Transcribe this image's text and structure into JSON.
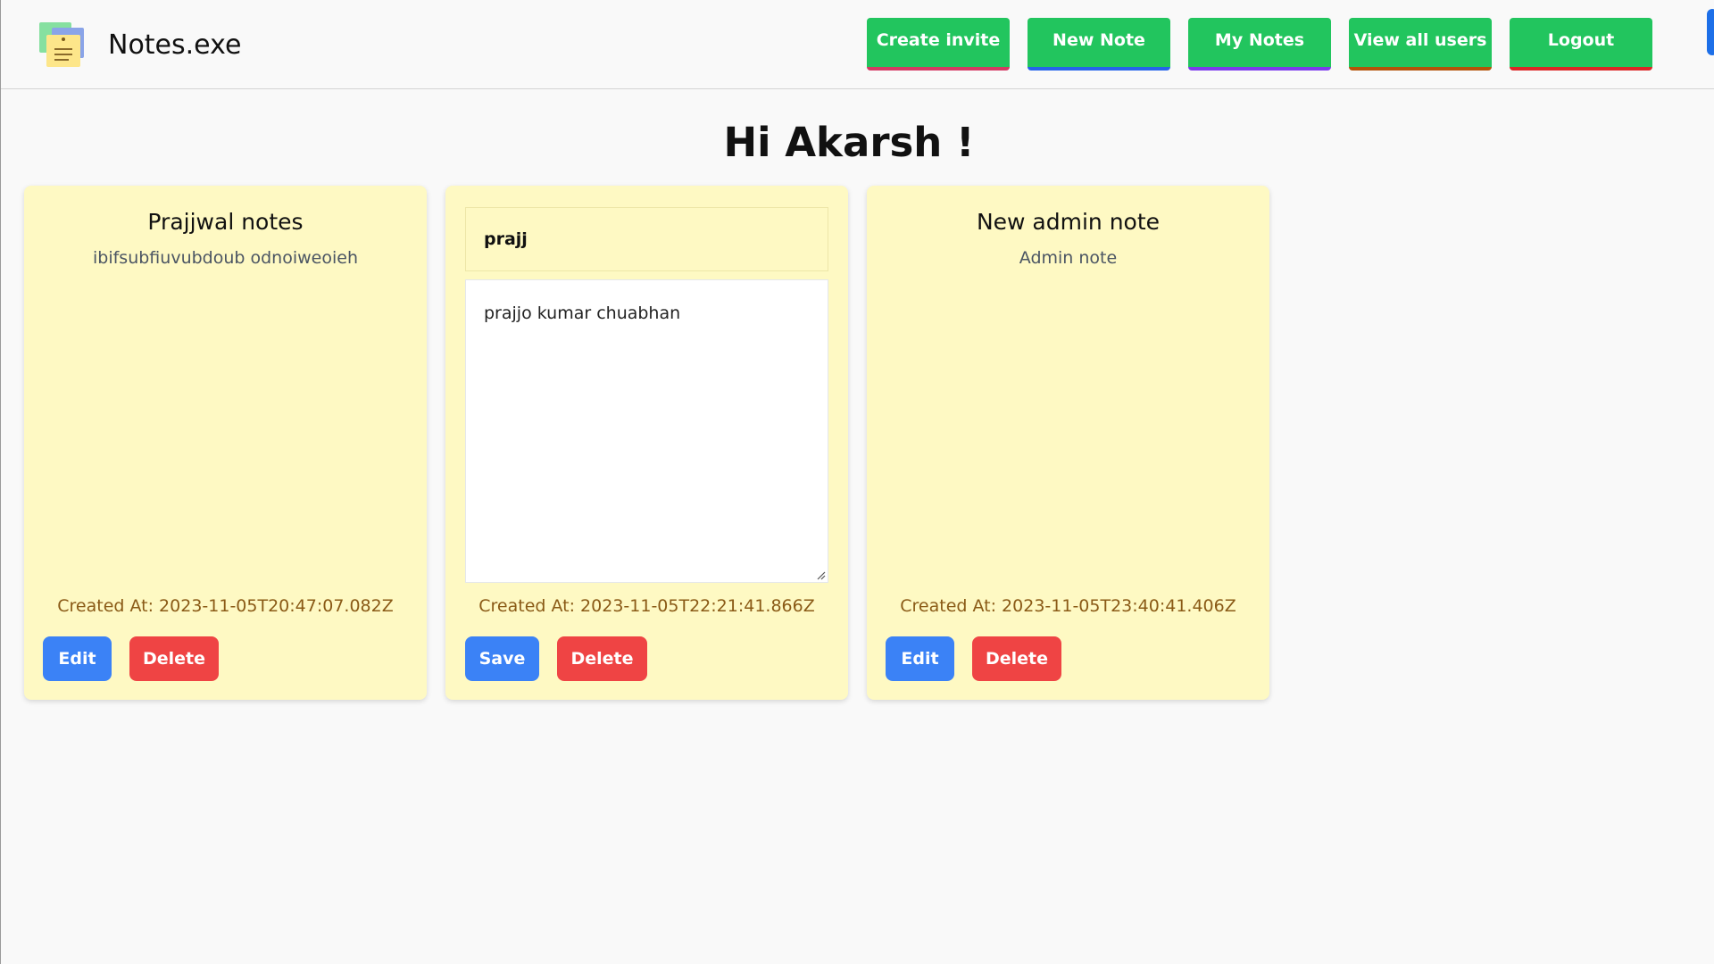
{
  "app": {
    "title": "Notes.exe"
  },
  "nav": {
    "create_invite": "Create invite",
    "new_note": "New Note",
    "my_notes": "My Notes",
    "view_all_users": "View all users",
    "logout": "Logout"
  },
  "greeting": "Hi Akarsh !",
  "notes": [
    {
      "title": "Prajjwal notes",
      "body": "ibifsubfiuvubdoub odnoiweoieh",
      "created_at": "Created At: 2023-11-05T20:47:07.082Z",
      "primary_button": "Edit",
      "delete_button": "Delete"
    },
    {
      "title_value": "prajj",
      "body_value": "prajjo kumar chuabhan",
      "created_at": "Created At: 2023-11-05T22:21:41.866Z",
      "primary_button": "Save",
      "delete_button": "Delete"
    },
    {
      "title": "New admin note",
      "body": "Admin note",
      "created_at": "Created At: 2023-11-05T23:40:41.406Z",
      "primary_button": "Edit",
      "delete_button": "Delete"
    }
  ],
  "icons": {
    "logo": "sticky-notes-icon",
    "resize": "resize-grip-icon"
  },
  "colors": {
    "nav_button": "#22c55e",
    "edit_button": "#3b82f6",
    "delete_button": "#ef4444",
    "card_background": "#fef9c3",
    "created_text": "#8a5a16"
  }
}
